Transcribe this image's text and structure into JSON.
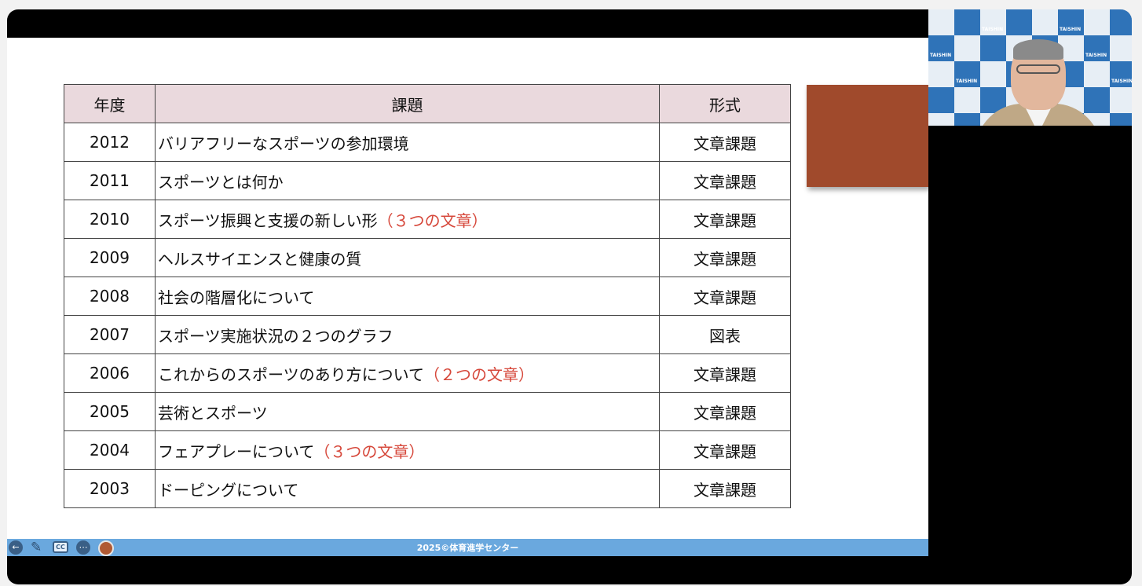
{
  "table": {
    "headers": {
      "year": "年度",
      "topic": "課題",
      "format": "形式"
    },
    "rows": [
      {
        "year": "2012",
        "topic": "バリアフリーなスポーツの参加環境",
        "note": "",
        "format": "文章課題"
      },
      {
        "year": "2011",
        "topic": "スポーツとは何か",
        "note": "",
        "format": "文章課題"
      },
      {
        "year": "2010",
        "topic": "スポーツ振興と支援の新しい形",
        "note": "（３つの文章）",
        "format": "文章課題"
      },
      {
        "year": "2009",
        "topic": "ヘルスサイエンスと健康の質",
        "note": "",
        "format": "文章課題"
      },
      {
        "year": "2008",
        "topic": "社会の階層化について",
        "note": "",
        "format": "文章課題"
      },
      {
        "year": "2007",
        "topic": "スポーツ実施状況の２つのグラフ",
        "note": "",
        "format": "図表"
      },
      {
        "year": "2006",
        "topic": "これからのスポーツのあり方について",
        "note": "（２つの文章）",
        "format": "文章課題"
      },
      {
        "year": "2005",
        "topic": "芸術とスポーツ",
        "note": "",
        "format": "文章課題"
      },
      {
        "year": "2004",
        "topic": "フェアプレーについて",
        "note": "（３つの文章）",
        "format": "文章課題"
      },
      {
        "year": "2003",
        "topic": "ドーピングについて",
        "note": "",
        "format": "文章課題"
      }
    ]
  },
  "footer": {
    "copyright": "2025©体育進学センター"
  },
  "webcam": {
    "backdrop_brand": "TAISHIN"
  },
  "toolbar": {
    "cc_label": "CC",
    "icons": [
      "back-arrow-icon",
      "pen-icon",
      "cc-icon",
      "more-icon",
      "user-icon"
    ]
  },
  "colors": {
    "accent_block": "#a04a2c",
    "note_text": "#d6473a",
    "header_bg": "#ead9dd",
    "toolbar": "#6aa8de"
  }
}
